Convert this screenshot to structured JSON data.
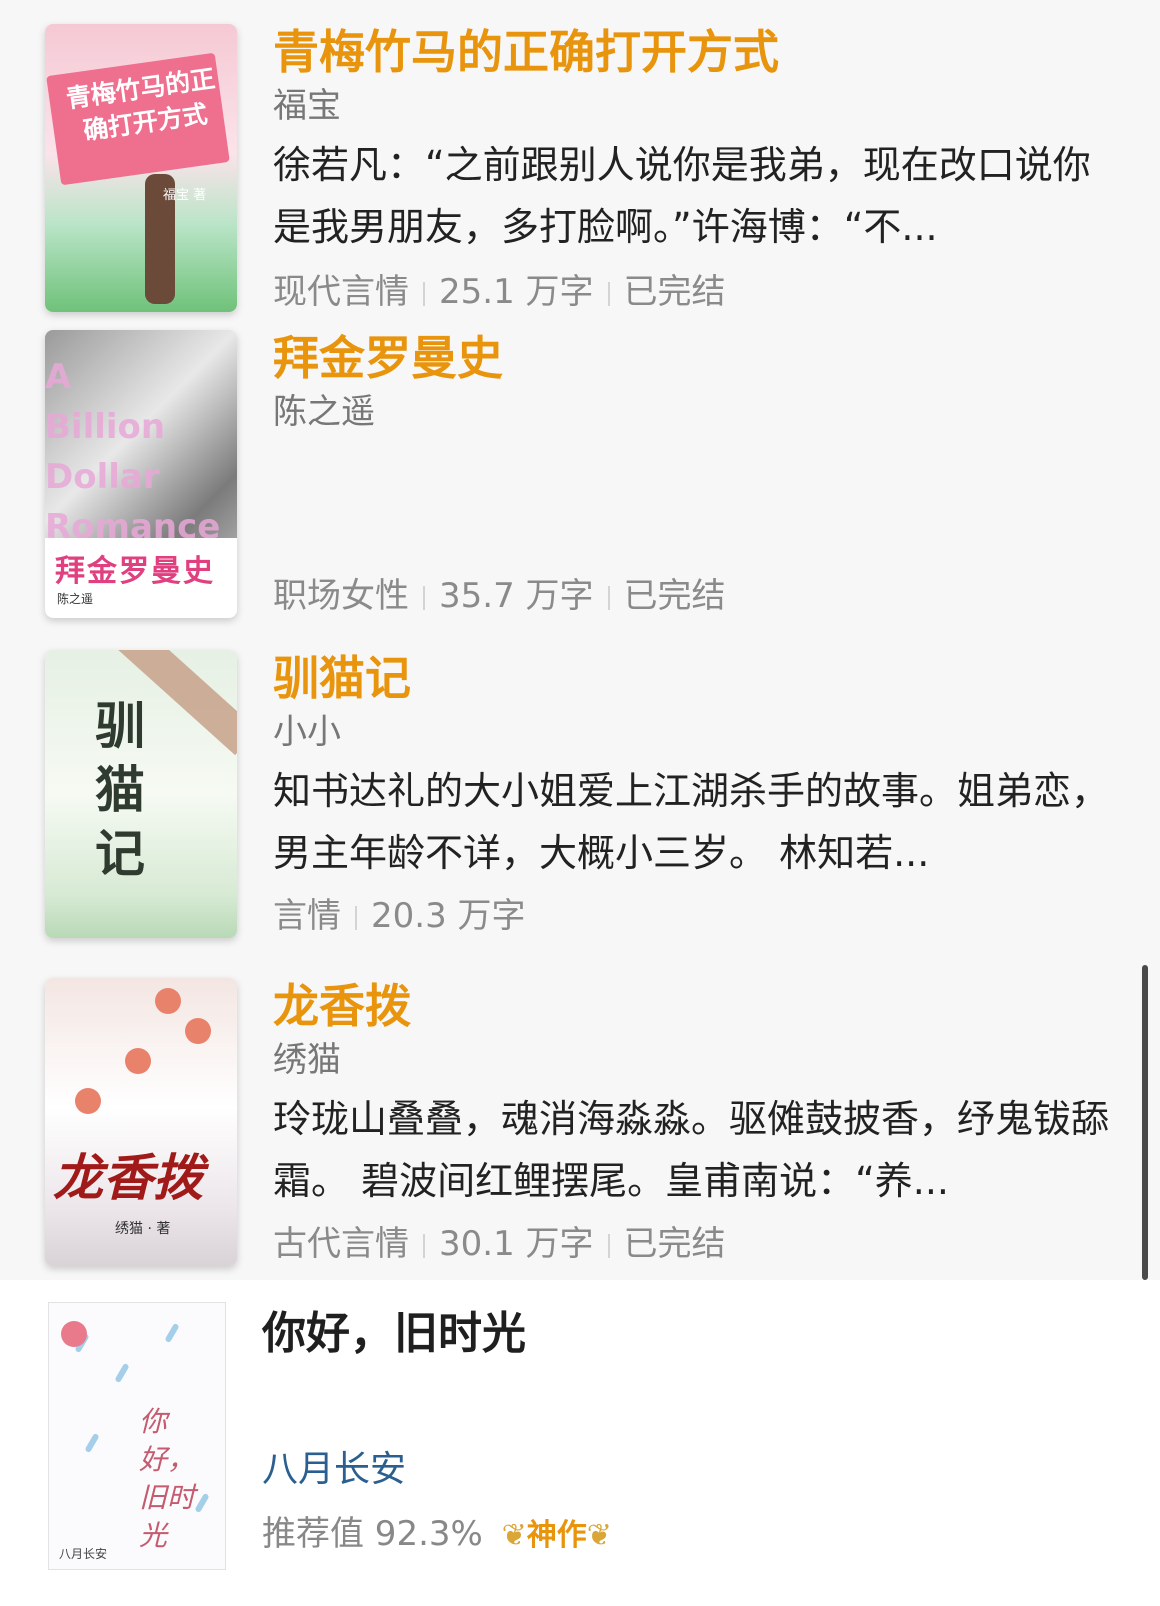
{
  "books": [
    {
      "title": "青梅竹马的正确打开方式",
      "author": "福宝",
      "description": "徐若凡：“之前跟别人说你是我弟，现在改口说你是我男朋友，多打脸啊。”许海博：“不...",
      "tags": [
        "现代言情",
        "25.1 万字",
        "已完结"
      ],
      "cover": {
        "title_text": "青梅竹马的正确打开方式",
        "author_text": "福宝 著"
      }
    },
    {
      "title": "拜金罗曼史",
      "author": "陈之遥",
      "description": "",
      "tags": [
        "职场女性",
        "35.7 万字",
        "已完结"
      ],
      "cover": {
        "title_text": "拜金罗曼史",
        "english_text": "A Billion Dollar Romance",
        "author_text": "陈之遥"
      }
    },
    {
      "title": "驯猫记",
      "author": "小小",
      "description": "知书达礼的大小姐爱上江湖杀手的故事。姐弟恋，男主年龄不详，大概小三岁。 林知若...",
      "tags": [
        "言情",
        "20.3 万字"
      ],
      "cover": {
        "title_text": "驯猫记"
      }
    },
    {
      "title": "龙香拨",
      "author": "绣猫",
      "description": "玲珑山叠叠，魂消海淼淼。驱傩鼓披香，纾鬼钹舔霜。 碧波间红鲤摆尾。皇甫南说：“养...",
      "tags": [
        "古代言情",
        "30.1 万字",
        "已完结"
      ],
      "cover": {
        "title_text": "龙香拨",
        "author_text": "绣猫 · 著"
      }
    }
  ],
  "featured": {
    "title": "你好，旧时光",
    "author": "八月长安",
    "recommend_label": "推荐值 92.3%",
    "recommend_value": 92.3,
    "badge": "神作",
    "cover": {
      "title_text": "你好，旧时光",
      "author_text": "八月长安"
    }
  },
  "colors": {
    "title": "#e8940c",
    "author_link": "#2a5f8f",
    "badge": "#e8940c"
  }
}
